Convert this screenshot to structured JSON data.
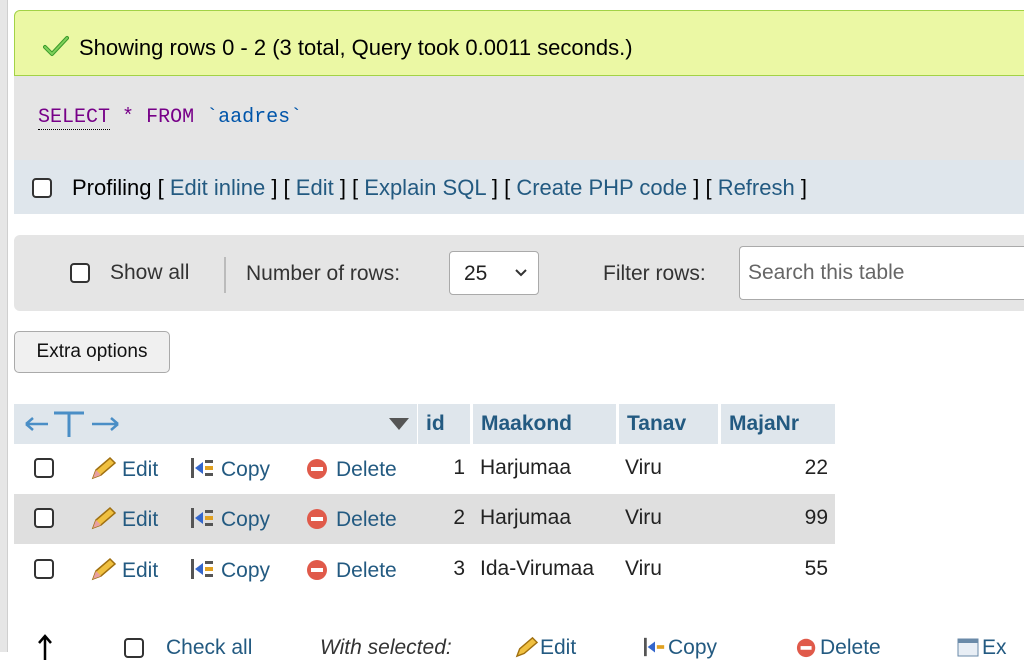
{
  "success": {
    "message": "Showing rows 0 - 2 (3 total, Query took 0.0011 seconds.)",
    "icon": "checkmark-icon"
  },
  "sql": {
    "select": "SELECT",
    "star": "*",
    "from": "FROM",
    "table": "`aadres`"
  },
  "profiling": {
    "label": "Profiling",
    "links": [
      "Edit inline",
      "Edit",
      "Explain SQL",
      "Create PHP code",
      "Refresh"
    ]
  },
  "nav": {
    "show_all": "Show all",
    "number_of_rows": "Number of rows:",
    "rows_value": "25",
    "filter_rows": "Filter rows:",
    "search_placeholder": "Search this table"
  },
  "extra_options": "Extra options",
  "table": {
    "columns": [
      "id",
      "Maakond",
      "Tanav",
      "MajaNr"
    ],
    "actions": {
      "edit": "Edit",
      "copy": "Copy",
      "delete": "Delete"
    },
    "rows": [
      {
        "id": "1",
        "maakond": "Harjumaa",
        "tanav": "Viru",
        "majanr": "22"
      },
      {
        "id": "2",
        "maakond": "Harjumaa",
        "tanav": "Viru",
        "majanr": "99"
      },
      {
        "id": "3",
        "maakond": "Ida-Virumaa",
        "tanav": "Viru",
        "majanr": "55"
      }
    ]
  },
  "bottom": {
    "check_all": "Check all",
    "with_selected": "With selected:",
    "edit": "Edit",
    "copy": "Copy",
    "delete": "Delete",
    "export": "Ex"
  },
  "colors": {
    "link": "#235a81",
    "success_bg": "#ebf8a4",
    "header_bg": "#dfe6ec",
    "delete_red": "#e05a4a"
  }
}
